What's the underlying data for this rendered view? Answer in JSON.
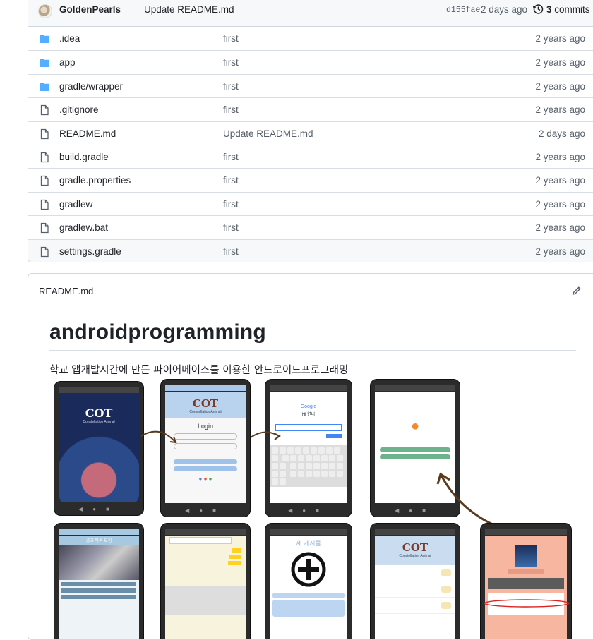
{
  "commit": {
    "author": "GoldenPearls",
    "message": "Update README.md",
    "sha": "d155fae",
    "when": "2 days ago",
    "commits_count": "3",
    "commits_label": "commits"
  },
  "files": [
    {
      "name": ".idea",
      "type": "folder",
      "message": "first",
      "age": "2 years ago"
    },
    {
      "name": "app",
      "type": "folder",
      "message": "first",
      "age": "2 years ago"
    },
    {
      "name": "gradle/wrapper",
      "type": "folder",
      "message": "first",
      "age": "2 years ago"
    },
    {
      "name": ".gitignore",
      "type": "file",
      "message": "first",
      "age": "2 years ago"
    },
    {
      "name": "README.md",
      "type": "file",
      "message": "Update README.md",
      "age": "2 days ago"
    },
    {
      "name": "build.gradle",
      "type": "file",
      "message": "first",
      "age": "2 years ago"
    },
    {
      "name": "gradle.properties",
      "type": "file",
      "message": "first",
      "age": "2 years ago"
    },
    {
      "name": "gradlew",
      "type": "file",
      "message": "first",
      "age": "2 years ago"
    },
    {
      "name": "gradlew.bat",
      "type": "file",
      "message": "first",
      "age": "2 years ago"
    },
    {
      "name": "settings.gradle",
      "type": "file",
      "message": "first",
      "age": "2 years ago"
    }
  ],
  "readme": {
    "file_title": "README.md",
    "heading": "androidprogramming",
    "paragraph": "학교 앱개발시간에 만든 파이어베이스를 이용한 안드로이드프로그래밍"
  },
  "screenshots": {
    "logo_text": "COT",
    "app_name": "Constellation Animal",
    "login_title": "Login",
    "google_label": "Google",
    "google_greeting": "Hi 연니",
    "board_title": "새 게시물",
    "board_top": "공고 목록 모집"
  },
  "colors": {
    "border": "#d0d7de",
    "header_bg": "#f6f8fa",
    "folder": "#54aeff",
    "muted": "#57606a"
  }
}
